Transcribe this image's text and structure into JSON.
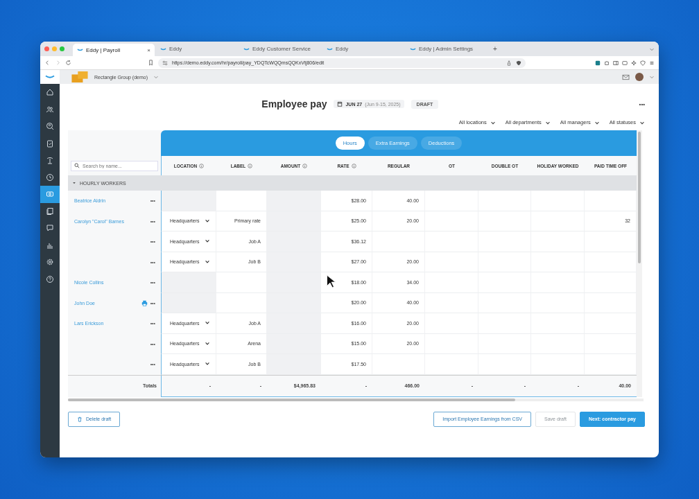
{
  "browser": {
    "tabs": [
      {
        "title": "Eddy | Payroll",
        "selected": true
      },
      {
        "title": "Eddy",
        "selected": false
      },
      {
        "title": "Eddy Customer Service",
        "selected": false
      },
      {
        "title": "Eddy",
        "selected": false
      },
      {
        "title": "Eddy | Admin Settings",
        "selected": false
      }
    ],
    "close": "×",
    "new_tab": "+",
    "url": "https://demo.eddy.com/hr/payroll/pay_YDQTcWQQmsQQKxVtj806/edit"
  },
  "app": {
    "org": "Rectangle Group (demo)"
  },
  "sidebar": {
    "items": [
      {
        "kind": "home",
        "selected": false
      },
      {
        "kind": "people",
        "selected": false
      },
      {
        "kind": "search",
        "selected": false
      },
      {
        "kind": "clipboard",
        "selected": false
      },
      {
        "kind": "palm",
        "selected": false
      },
      {
        "kind": "clock",
        "selected": false
      },
      {
        "kind": "payroll",
        "selected": true
      },
      {
        "kind": "documents",
        "selected": false
      },
      {
        "kind": "chat",
        "selected": false
      },
      {
        "kind": "chart",
        "selected": false
      },
      {
        "kind": "settings",
        "selected": false
      },
      {
        "kind": "help",
        "selected": false
      }
    ]
  },
  "page": {
    "title": "Employee pay",
    "pay_date": "JUN 27",
    "period": "(Jun 9-15, 2025)",
    "status": "DRAFT",
    "more": "•••"
  },
  "filters": [
    "All locations",
    "All departments",
    "All managers",
    "All statuses"
  ],
  "tabs": [
    {
      "label": "Hours",
      "selected": true
    },
    {
      "label": "Extra Earnings",
      "selected": false
    },
    {
      "label": "Deductions",
      "selected": false
    }
  ],
  "search": {
    "placeholder": "Search by name..."
  },
  "columns": [
    {
      "label": "LOCATION",
      "info": true,
      "kind": "select"
    },
    {
      "label": "LABEL",
      "info": true,
      "kind": "text"
    },
    {
      "label": "AMOUNT",
      "info": true,
      "kind": "readonly"
    },
    {
      "label": "RATE",
      "info": true,
      "kind": "text"
    },
    {
      "label": "REGULAR",
      "info": false,
      "kind": "text"
    },
    {
      "label": "OT",
      "info": false,
      "kind": "text"
    },
    {
      "label": "DOUBLE OT",
      "info": false,
      "kind": "text"
    },
    {
      "label": "HOLIDAY WORKED",
      "info": false,
      "kind": "text"
    },
    {
      "label": "PAID TIME OFF",
      "info": false,
      "kind": "text"
    }
  ],
  "group": {
    "label": "HOURLY WORKERS",
    "expanded": true
  },
  "rows": [
    {
      "name": "Beatrice Aldrin",
      "printer": false,
      "more": "•••",
      "cells": [
        null,
        null,
        null,
        "$28.00",
        "40.00",
        null,
        null,
        null,
        null
      ]
    },
    {
      "name": "Carolyn \"Carol\" Barnes",
      "printer": false,
      "more": "•••",
      "cells": [
        "Headquarters",
        "Primary rate",
        null,
        "$25.00",
        "20.00",
        null,
        null,
        null,
        "32"
      ]
    },
    {
      "printer": false,
      "more": "•••",
      "cells": [
        "Headquarters",
        "Job A",
        null,
        "$36.12",
        null,
        null,
        null,
        null,
        null
      ]
    },
    {
      "printer": false,
      "more": "•••",
      "cells": [
        "Headquarters",
        "Job B",
        null,
        "$27.00",
        "20.00",
        null,
        null,
        null,
        null
      ]
    },
    {
      "name": "Nicole Collins",
      "printer": false,
      "more": "•••",
      "cells": [
        null,
        null,
        null,
        "$18.00",
        "34.00",
        null,
        null,
        null,
        null
      ]
    },
    {
      "name": "John Doe",
      "printer": true,
      "more": "•••",
      "cells": [
        null,
        null,
        null,
        "$20.00",
        "40.00",
        null,
        null,
        null,
        null
      ]
    },
    {
      "name": "Lars Erickson",
      "printer": false,
      "more": "•••",
      "cells": [
        "Headquarters",
        "Job A",
        null,
        "$16.00",
        "20.00",
        null,
        null,
        null,
        null
      ]
    },
    {
      "printer": false,
      "more": "•••",
      "cells": [
        "Headquarters",
        "Arena",
        null,
        "$15.00",
        "20.00",
        null,
        null,
        null,
        null
      ]
    },
    {
      "printer": false,
      "more": "•••",
      "cells": [
        "Headquarters",
        "Job B",
        null,
        "$17.50",
        null,
        null,
        null,
        null,
        null
      ]
    }
  ],
  "totals": {
    "label": "Totals",
    "values": [
      "-",
      "-",
      "$4,965.83",
      "-",
      "466.00",
      "-",
      "-",
      "-",
      "40.00"
    ]
  },
  "actions": {
    "delete": "Delete draft",
    "import": "Import Employee Earnings from CSV",
    "save": {
      "label": "Save draft",
      "disabled": true
    },
    "next": "Next: contractor pay"
  }
}
